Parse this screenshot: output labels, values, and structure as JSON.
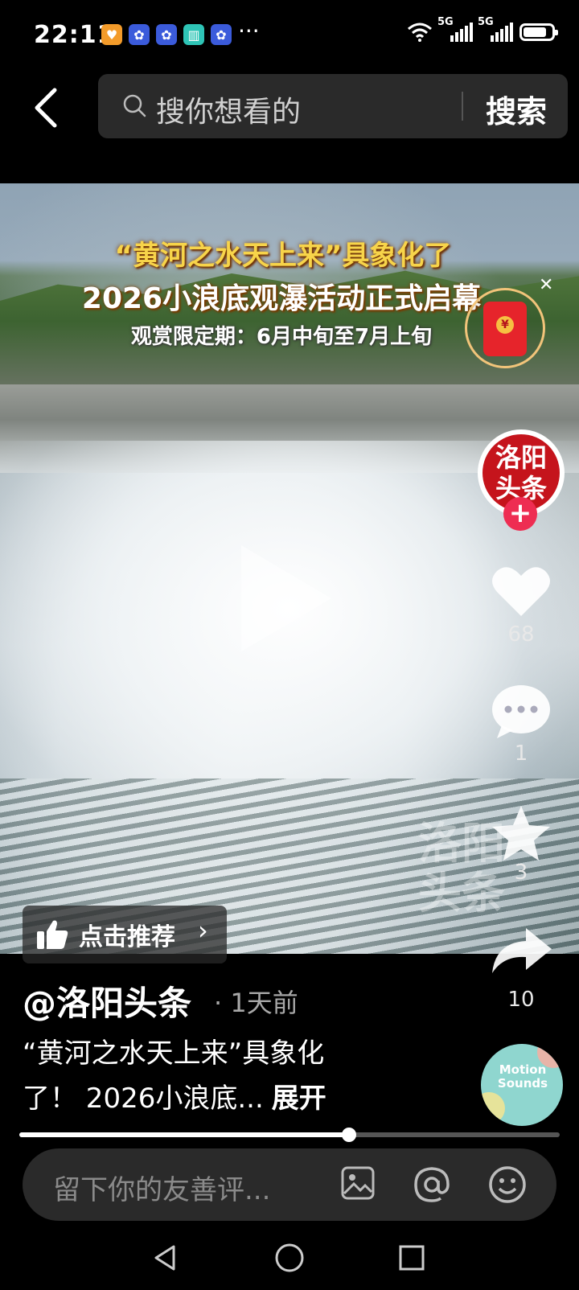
{
  "status_bar": {
    "time": "22:11",
    "more": "···",
    "network1": "5G",
    "network2": "5G"
  },
  "search": {
    "placeholder": "搜你想看的",
    "button": "搜索"
  },
  "video": {
    "caption_line1": "“黄河之水天上来”具象化了",
    "caption_line2": "2026小浪底观瀑活动正式启幕",
    "caption_line3": "观赏限定期：6月中旬至7月上旬",
    "watermark": "洛阳头条",
    "recommend_label": "点击推荐"
  },
  "account": {
    "avatar_text_top": "洛阳",
    "avatar_text_bottom": "头条",
    "follow": "+"
  },
  "rail": {
    "likes": "68",
    "comments": "1",
    "favorites": "3",
    "shares": "10"
  },
  "post": {
    "author": "@洛阳头条",
    "time_ago": "· 1天前",
    "desc_line1": "“黄河之水天上来”具象化",
    "desc_line2": "了！ 2026小浪底...",
    "expand": "展开",
    "music_title": "Motion Sounds",
    "progress_percent": 61
  },
  "comment_box": {
    "placeholder": "留下你的友善评..."
  },
  "colors": {
    "accent_red": "#ee2d52",
    "brand_red": "#c5141c",
    "caption_yellow": "#f7d44a"
  }
}
